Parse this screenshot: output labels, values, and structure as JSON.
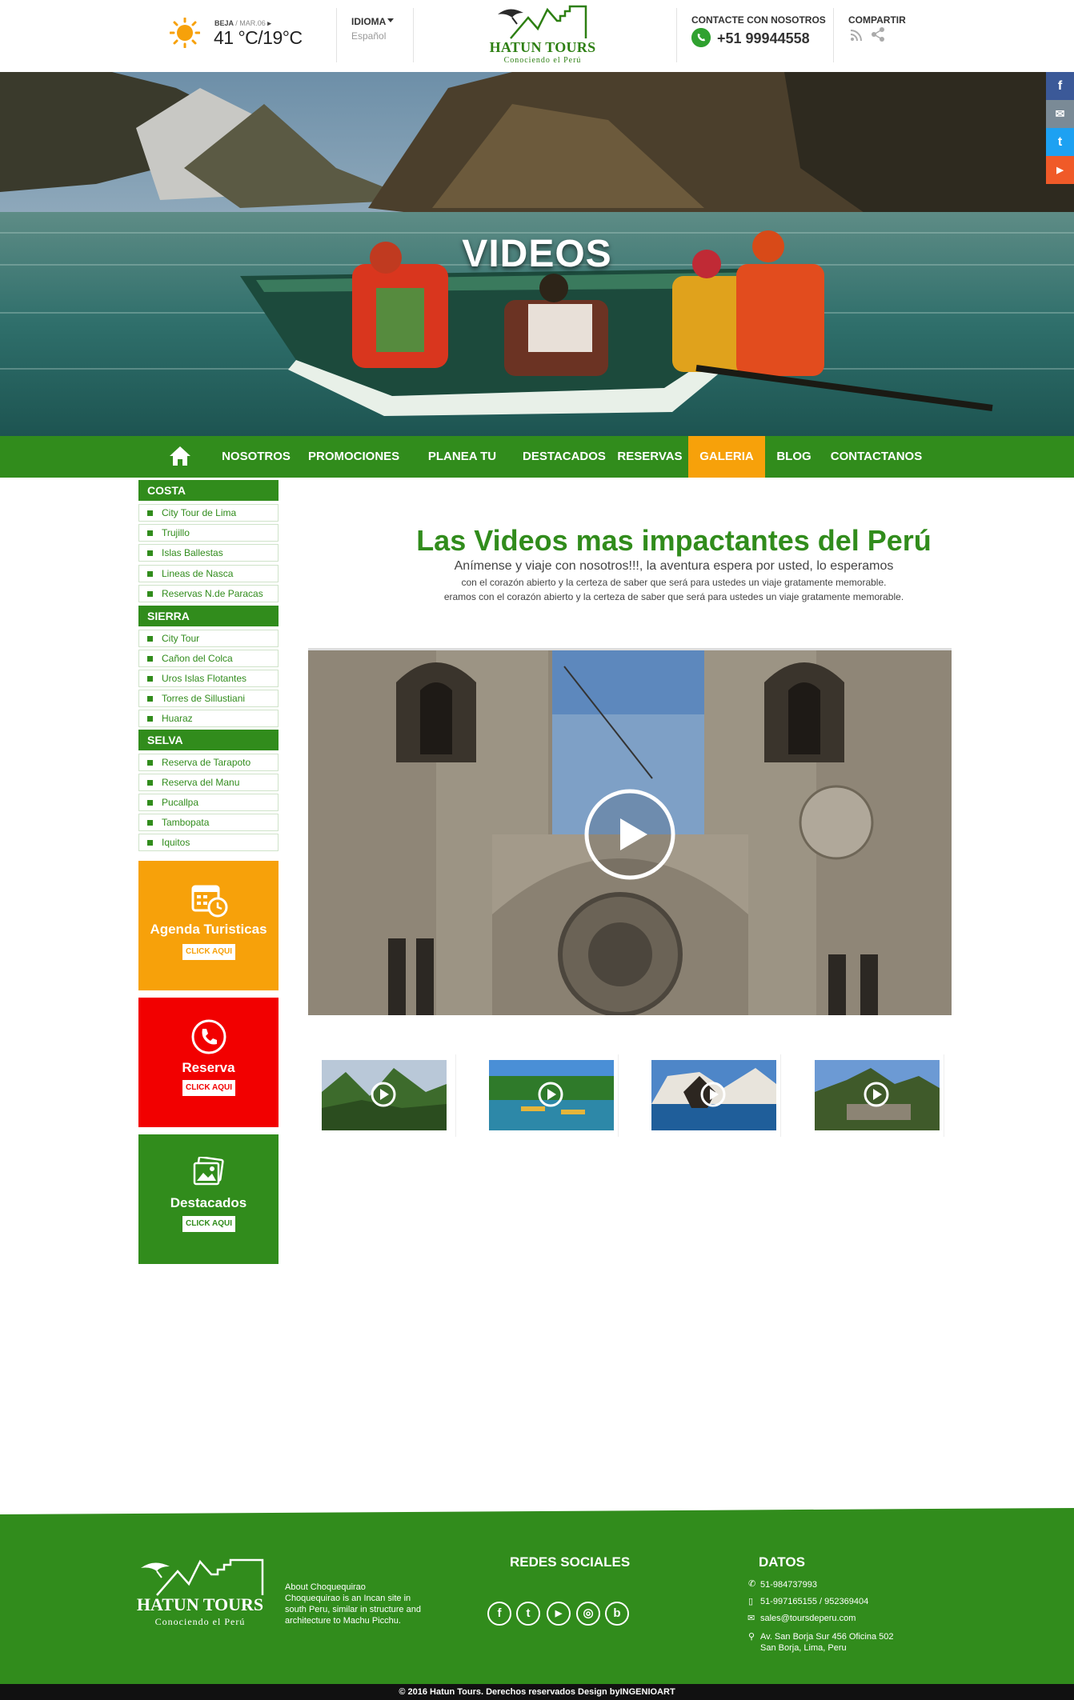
{
  "header": {
    "weather": {
      "location": "BEJA",
      "date": "/ MAR.06",
      "temp": "41 °C/19°C"
    },
    "language": {
      "label": "IDIOMA",
      "value": "Español"
    },
    "logo": {
      "title": "HATUN TOURS",
      "tagline": "Conociendo el Perú"
    },
    "contact": {
      "label": "CONTACTE CON NOSOTROS",
      "phone": "+51 99944558"
    },
    "share": {
      "label": "COMPARTIR"
    }
  },
  "hero": {
    "title": "VIDEOS"
  },
  "side_social": [
    {
      "icon": "facebook-icon",
      "glyph": "f",
      "color": "#3b5998"
    },
    {
      "icon": "mail-icon",
      "glyph": "✉",
      "color": "#7a8a96"
    },
    {
      "icon": "twitter-icon",
      "glyph": "t",
      "color": "#1da1f2"
    },
    {
      "icon": "youtube-icon",
      "glyph": "▶",
      "color": "#f05a28"
    }
  ],
  "nav": {
    "items": [
      "NOSOTROS",
      "PROMOCIONES",
      "PLANEA TU VIAJE",
      "DESTACADOS",
      "RESERVAS",
      "GALERIA",
      "BLOG",
      "CONTACTANOS"
    ],
    "active": "GALERIA"
  },
  "sidebar": {
    "categories": [
      {
        "name": "COSTA",
        "items": [
          "City Tour de Lima",
          "Trujillo",
          "Islas Ballestas",
          "Lineas de Nasca",
          "Reservas N.de Paracas"
        ]
      },
      {
        "name": "SIERRA",
        "items": [
          "City Tour",
          "Cañon del Colca",
          "Uros Islas Flotantes",
          "Torres de Sillustiani",
          "Huaraz"
        ]
      },
      {
        "name": "SELVA",
        "items": [
          "Reserva de Tarapoto",
          "Reserva del Manu",
          "Pucallpa",
          "Tambopata",
          "Iquitos"
        ]
      }
    ],
    "promos": [
      {
        "title": "Agenda Turisticas",
        "button": "CLICK AQUI",
        "color": "#f7a10a",
        "icon": "calendar-icon"
      },
      {
        "title": "Reserva",
        "button": "CLICK AQUI",
        "color": "#f20000",
        "icon": "phone-icon"
      },
      {
        "title": "Destacados",
        "button": "CLICK AQUI",
        "color": "#318c1c",
        "icon": "photos-icon"
      }
    ]
  },
  "main": {
    "title": "Las Videos mas impactantes del Perú",
    "subtitle": "Anímense y viaje con nosotros!!!, la aventura espera por usted, lo esperamos",
    "line1": "con el corazón abierto y la certeza de saber que será para ustedes un viaje gratamente memorable.",
    "line2": "eramos con el corazón abierto y la certeza de saber que será para ustedes un viaje gratamente memorable."
  },
  "footer": {
    "logo": {
      "title": "HATUN TOURS",
      "tagline": "Conociendo el Perú"
    },
    "about": "About Choquequirao\nChoquequirao is an Incan site in south Peru, similar in structure and architecture to Machu Picchu.",
    "social_title": "REDES SOCIALES",
    "social": [
      "f",
      "t",
      "▶",
      "◎",
      "b"
    ],
    "data_title": "DATOS",
    "phone1": "51-984737993",
    "phone2": "51-997165155 / 952369404",
    "email": "sales@toursdeperu.com",
    "address": "Av. San Borja Sur 456 Oficina 502\nSan Borja, Lima, Peru",
    "copyright": "© 2016  Hatun Tours. Derechos reservados Design byINGENIOART"
  }
}
